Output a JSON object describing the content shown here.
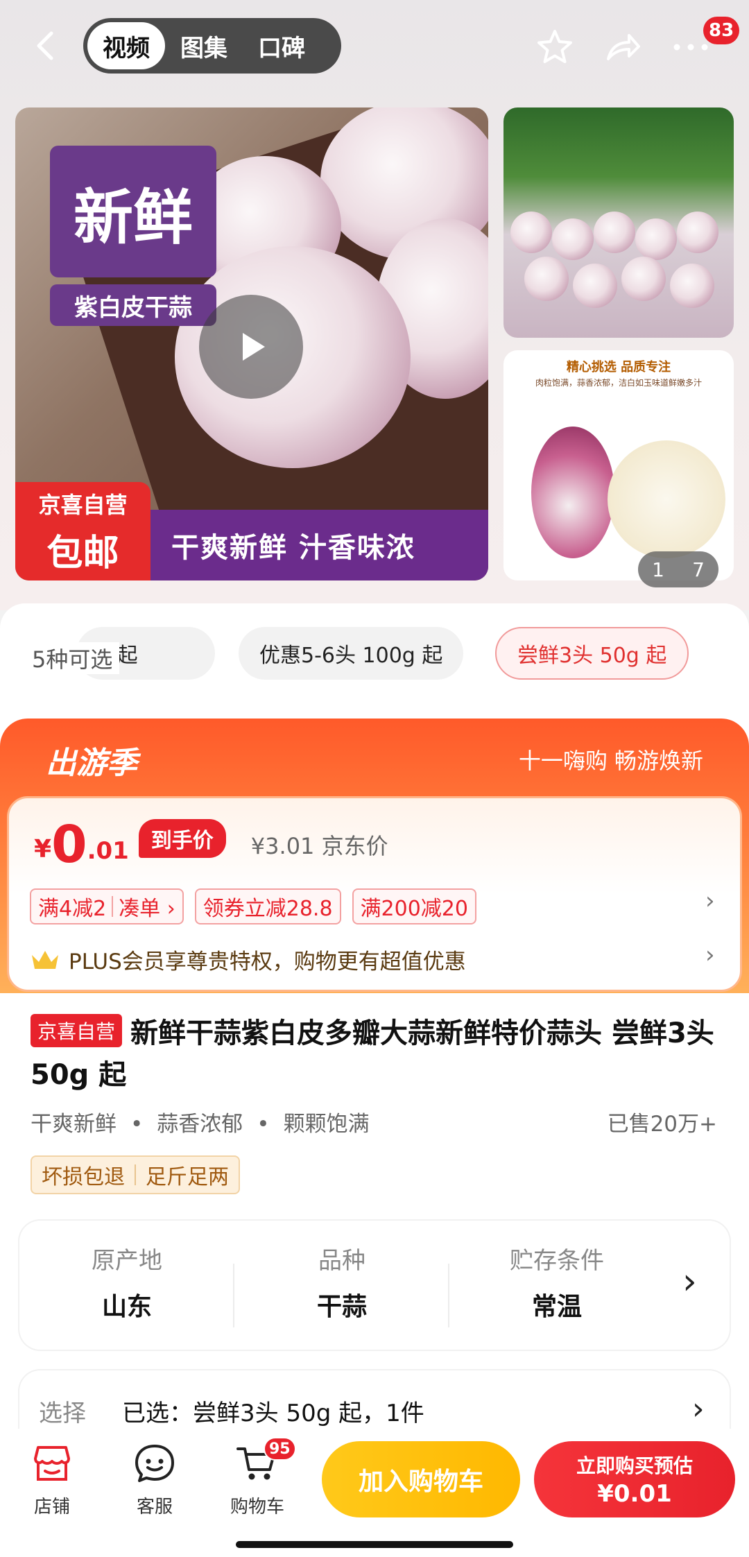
{
  "header": {
    "tabs": [
      {
        "label": "视频",
        "active": true
      },
      {
        "label": "图集",
        "active": false
      },
      {
        "label": "口碑",
        "active": false
      }
    ],
    "message_badge": "83"
  },
  "media": {
    "main_tag": "新鲜",
    "main_sub": "紫白皮干蒜",
    "red_tag_line1": "京喜自营",
    "red_tag_line2": "包邮",
    "purple_banner": "干爽新鲜 汁香味浓",
    "side2_title": "精心挑选 品质专注",
    "side2_sub": "肉粒饱满，蒜香浓郁，洁白如玉味道鲜嫩多汁",
    "counter_current": "1",
    "counter_total": "7"
  },
  "variants": {
    "count_label": "5种可选",
    "chips": [
      "g 起",
      "优惠5-6头 100g 起",
      "尝鲜3头 50g 起"
    ]
  },
  "promo": {
    "season": "出游季",
    "slogan": "十一嗨购 畅游焕新",
    "yen": "¥",
    "price_int": "0",
    "price_dec": ".01",
    "price_tag": "到手价",
    "jd_price": "¥3.01 京东价",
    "coupons": [
      {
        "left": "满4减2",
        "right": "凑单 ›"
      },
      {
        "label": "领券立减28.8"
      },
      {
        "label": "满200减20"
      }
    ],
    "plus_text": "PLUS会员享尊贵特权，购物更有超值优惠"
  },
  "product": {
    "self_tag": "京喜自营",
    "title": "新鲜干蒜紫白皮多瓣大蒜新鲜特价蒜头 尝鲜3头 50g 起",
    "features": [
      "干爽新鲜",
      "蒜香浓郁",
      "颗颗饱满"
    ],
    "sold": "已售20万+",
    "guarantees": [
      "坏损包退",
      "足斤足两"
    ]
  },
  "attributes": [
    {
      "label": "原产地",
      "value": "山东"
    },
    {
      "label": "品种",
      "value": "干蒜"
    },
    {
      "label": "贮存条件",
      "value": "常温"
    }
  ],
  "selection": {
    "label": "选择",
    "value": "已选：尝鲜3头 50g 起，1件"
  },
  "bottom_bar": {
    "shop": "店铺",
    "service": "客服",
    "cart": "购物车",
    "cart_badge": "95",
    "add_to_cart": "加入购物车",
    "buy_now_line1": "立即购买预估",
    "buy_now_line2": "¥0.01"
  },
  "colors": {
    "accent_red": "#e8222c",
    "promo_orange": "#ff5a2a",
    "cart_yellow": "#ffb800"
  }
}
